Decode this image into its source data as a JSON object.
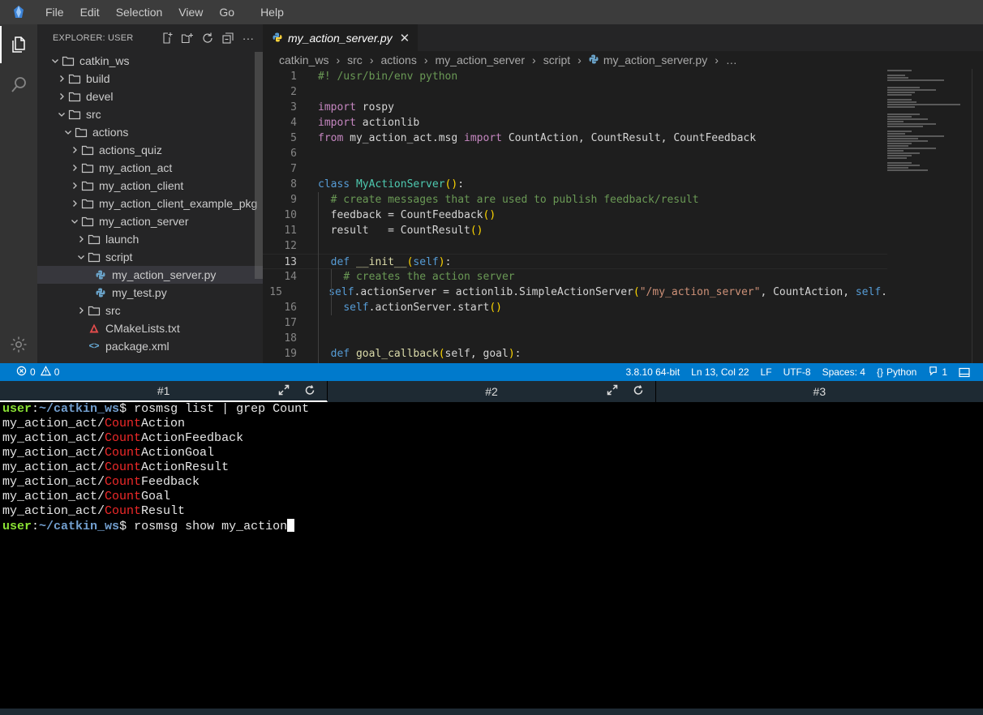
{
  "menu": [
    "File",
    "Edit",
    "Selection",
    "View",
    "Go",
    "Help"
  ],
  "explorer": {
    "title": "EXPLORER: USER",
    "tree": [
      {
        "label": "catkin_ws",
        "depth": 0,
        "type": "folder",
        "open": true
      },
      {
        "label": "build",
        "depth": 1,
        "type": "folder",
        "open": false
      },
      {
        "label": "devel",
        "depth": 1,
        "type": "folder",
        "open": false
      },
      {
        "label": "src",
        "depth": 1,
        "type": "folder",
        "open": true
      },
      {
        "label": "actions",
        "depth": 2,
        "type": "folder",
        "open": true
      },
      {
        "label": "actions_quiz",
        "depth": 3,
        "type": "folder",
        "open": false
      },
      {
        "label": "my_action_act",
        "depth": 3,
        "type": "folder",
        "open": false
      },
      {
        "label": "my_action_client",
        "depth": 3,
        "type": "folder",
        "open": false
      },
      {
        "label": "my_action_client_example_pkg",
        "depth": 3,
        "type": "folder",
        "open": false
      },
      {
        "label": "my_action_server",
        "depth": 3,
        "type": "folder",
        "open": true
      },
      {
        "label": "launch",
        "depth": 4,
        "type": "folder",
        "open": false
      },
      {
        "label": "script",
        "depth": 4,
        "type": "folder",
        "open": true
      },
      {
        "label": "my_action_server.py",
        "depth": 5,
        "type": "python",
        "selected": true
      },
      {
        "label": "my_test.py",
        "depth": 5,
        "type": "python"
      },
      {
        "label": "src",
        "depth": 4,
        "type": "folder",
        "open": false
      },
      {
        "label": "CMakeLists.txt",
        "depth": 4,
        "type": "cmake"
      },
      {
        "label": "package.xml",
        "depth": 4,
        "type": "xml"
      }
    ]
  },
  "editor": {
    "tab_label": "my_action_server.py",
    "breadcrumb": [
      "catkin_ws",
      "src",
      "actions",
      "my_action_server",
      "script",
      "my_action_server.py",
      "…"
    ],
    "lines": [
      {
        "n": "1",
        "html": "<span class='cm'>#! /usr/bin/env python</span>"
      },
      {
        "n": "2",
        "html": ""
      },
      {
        "n": "3",
        "html": "<span class='kw'>import</span> rospy"
      },
      {
        "n": "4",
        "html": "<span class='kw'>import</span> actionlib"
      },
      {
        "n": "5",
        "html": "<span class='kw'>from</span> my_action_act.msg <span class='kw'>import</span> CountAction, CountResult, CountFeedback"
      },
      {
        "n": "6",
        "html": ""
      },
      {
        "n": "7",
        "html": ""
      },
      {
        "n": "8",
        "html": "<span class='kwd'>class</span> <span class='cls'>MyActionServer</span><span class='par'>()</span>:"
      },
      {
        "n": "9",
        "html": "  <span class='cm'># create messages that are used to publish feedback/result</span>"
      },
      {
        "n": "10",
        "html": "  feedback = CountFeedback<span class='par'>()</span>"
      },
      {
        "n": "11",
        "html": "  result   = CountResult<span class='par'>()</span>"
      },
      {
        "n": "12",
        "html": ""
      },
      {
        "n": "13",
        "html": "  <span class='kwd'>def</span> <span class='fn'>__init__</span><span class='par'>(</span><span class='self'>self</span><span class='par'>)</span>:",
        "current": true
      },
      {
        "n": "14",
        "html": "    <span class='cm'># creates the action server</span>"
      },
      {
        "n": "15",
        "html": "    <span class='self'>self</span>.actionServer = actionlib.SimpleActionServer<span class='par'>(</span><span class='str'>\"/my_action_server\"</span>, CountAction, <span class='self'>self</span>."
      },
      {
        "n": "16",
        "html": "    <span class='self'>self</span>.actionServer.start<span class='par'>()</span>"
      },
      {
        "n": "17",
        "html": ""
      },
      {
        "n": "18",
        "html": ""
      },
      {
        "n": "19",
        "html": "  <span class='kwd'>def</span> <span class='fn'>goal_callback</span><span class='par'>(</span>self, goal<span class='par'>)</span>:"
      }
    ]
  },
  "status": {
    "errors": "0",
    "warnings": "0",
    "interpreter": "3.8.10 64-bit",
    "position": "Ln 13, Col 22",
    "eol": "LF",
    "encoding": "UTF-8",
    "spaces": "Spaces: 4",
    "language": "Python",
    "notifications": "1"
  },
  "terminal_tabs": [
    "#1",
    "#2",
    "#3"
  ],
  "terminal": {
    "prompt_user": "user",
    "prompt_path": "~/catkin_ws",
    "cmd1": "rosmsg list | grep Count",
    "output": [
      {
        "prefix": "my_action_act/",
        "match": "Count",
        "suffix": "Action"
      },
      {
        "prefix": "my_action_act/",
        "match": "Count",
        "suffix": "ActionFeedback"
      },
      {
        "prefix": "my_action_act/",
        "match": "Count",
        "suffix": "ActionGoal"
      },
      {
        "prefix": "my_action_act/",
        "match": "Count",
        "suffix": "ActionResult"
      },
      {
        "prefix": "my_action_act/",
        "match": "Count",
        "suffix": "Feedback"
      },
      {
        "prefix": "my_action_act/",
        "match": "Count",
        "suffix": "Goal"
      },
      {
        "prefix": "my_action_act/",
        "match": "Count",
        "suffix": "Result"
      }
    ],
    "cmd2": "rosmsg show my_action"
  }
}
